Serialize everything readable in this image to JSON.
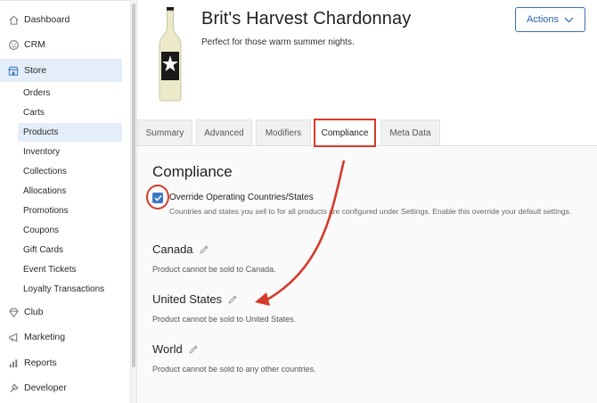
{
  "sidebar": {
    "items": [
      {
        "label": "Dashboard",
        "icon": "home-icon"
      },
      {
        "label": "CRM",
        "icon": "crm-icon"
      },
      {
        "label": "Store",
        "icon": "store-icon"
      }
    ],
    "store_subitems": [
      "Orders",
      "Carts",
      "Products",
      "Inventory",
      "Collections",
      "Allocations",
      "Promotions",
      "Coupons",
      "Gift Cards",
      "Event Tickets",
      "Loyalty Transactions"
    ],
    "bottom_items": [
      {
        "label": "Club",
        "icon": "diamond-icon"
      },
      {
        "label": "Marketing",
        "icon": "megaphone-icon"
      },
      {
        "label": "Reports",
        "icon": "bar-chart-icon"
      },
      {
        "label": "Developer",
        "icon": "wrench-icon"
      }
    ]
  },
  "product": {
    "title": "Brit's Harvest Chardonnay",
    "subtitle": "Perfect for those warm summer nights."
  },
  "actions": {
    "label": "Actions"
  },
  "tabs": [
    {
      "label": "Summary"
    },
    {
      "label": "Advanced"
    },
    {
      "label": "Modifiers"
    },
    {
      "label": "Compliance"
    },
    {
      "label": "Meta Data"
    }
  ],
  "compliance": {
    "title": "Compliance",
    "override_label": "Override Operating Countries/States",
    "override_checked": true,
    "override_help": "Countries and states you sell to for all products are configured under Settings. Enable this override your default settings.",
    "regions": [
      {
        "name": "Canada",
        "note": "Product cannot be sold to Canada."
      },
      {
        "name": "United States",
        "note": "Product cannot be sold to United States."
      },
      {
        "name": "World",
        "note": "Product cannot be sold to any other countries."
      }
    ]
  },
  "colors": {
    "accent": "#3b78c4",
    "annotation": "#d63a2a",
    "active_nav": "#e4eef8"
  }
}
